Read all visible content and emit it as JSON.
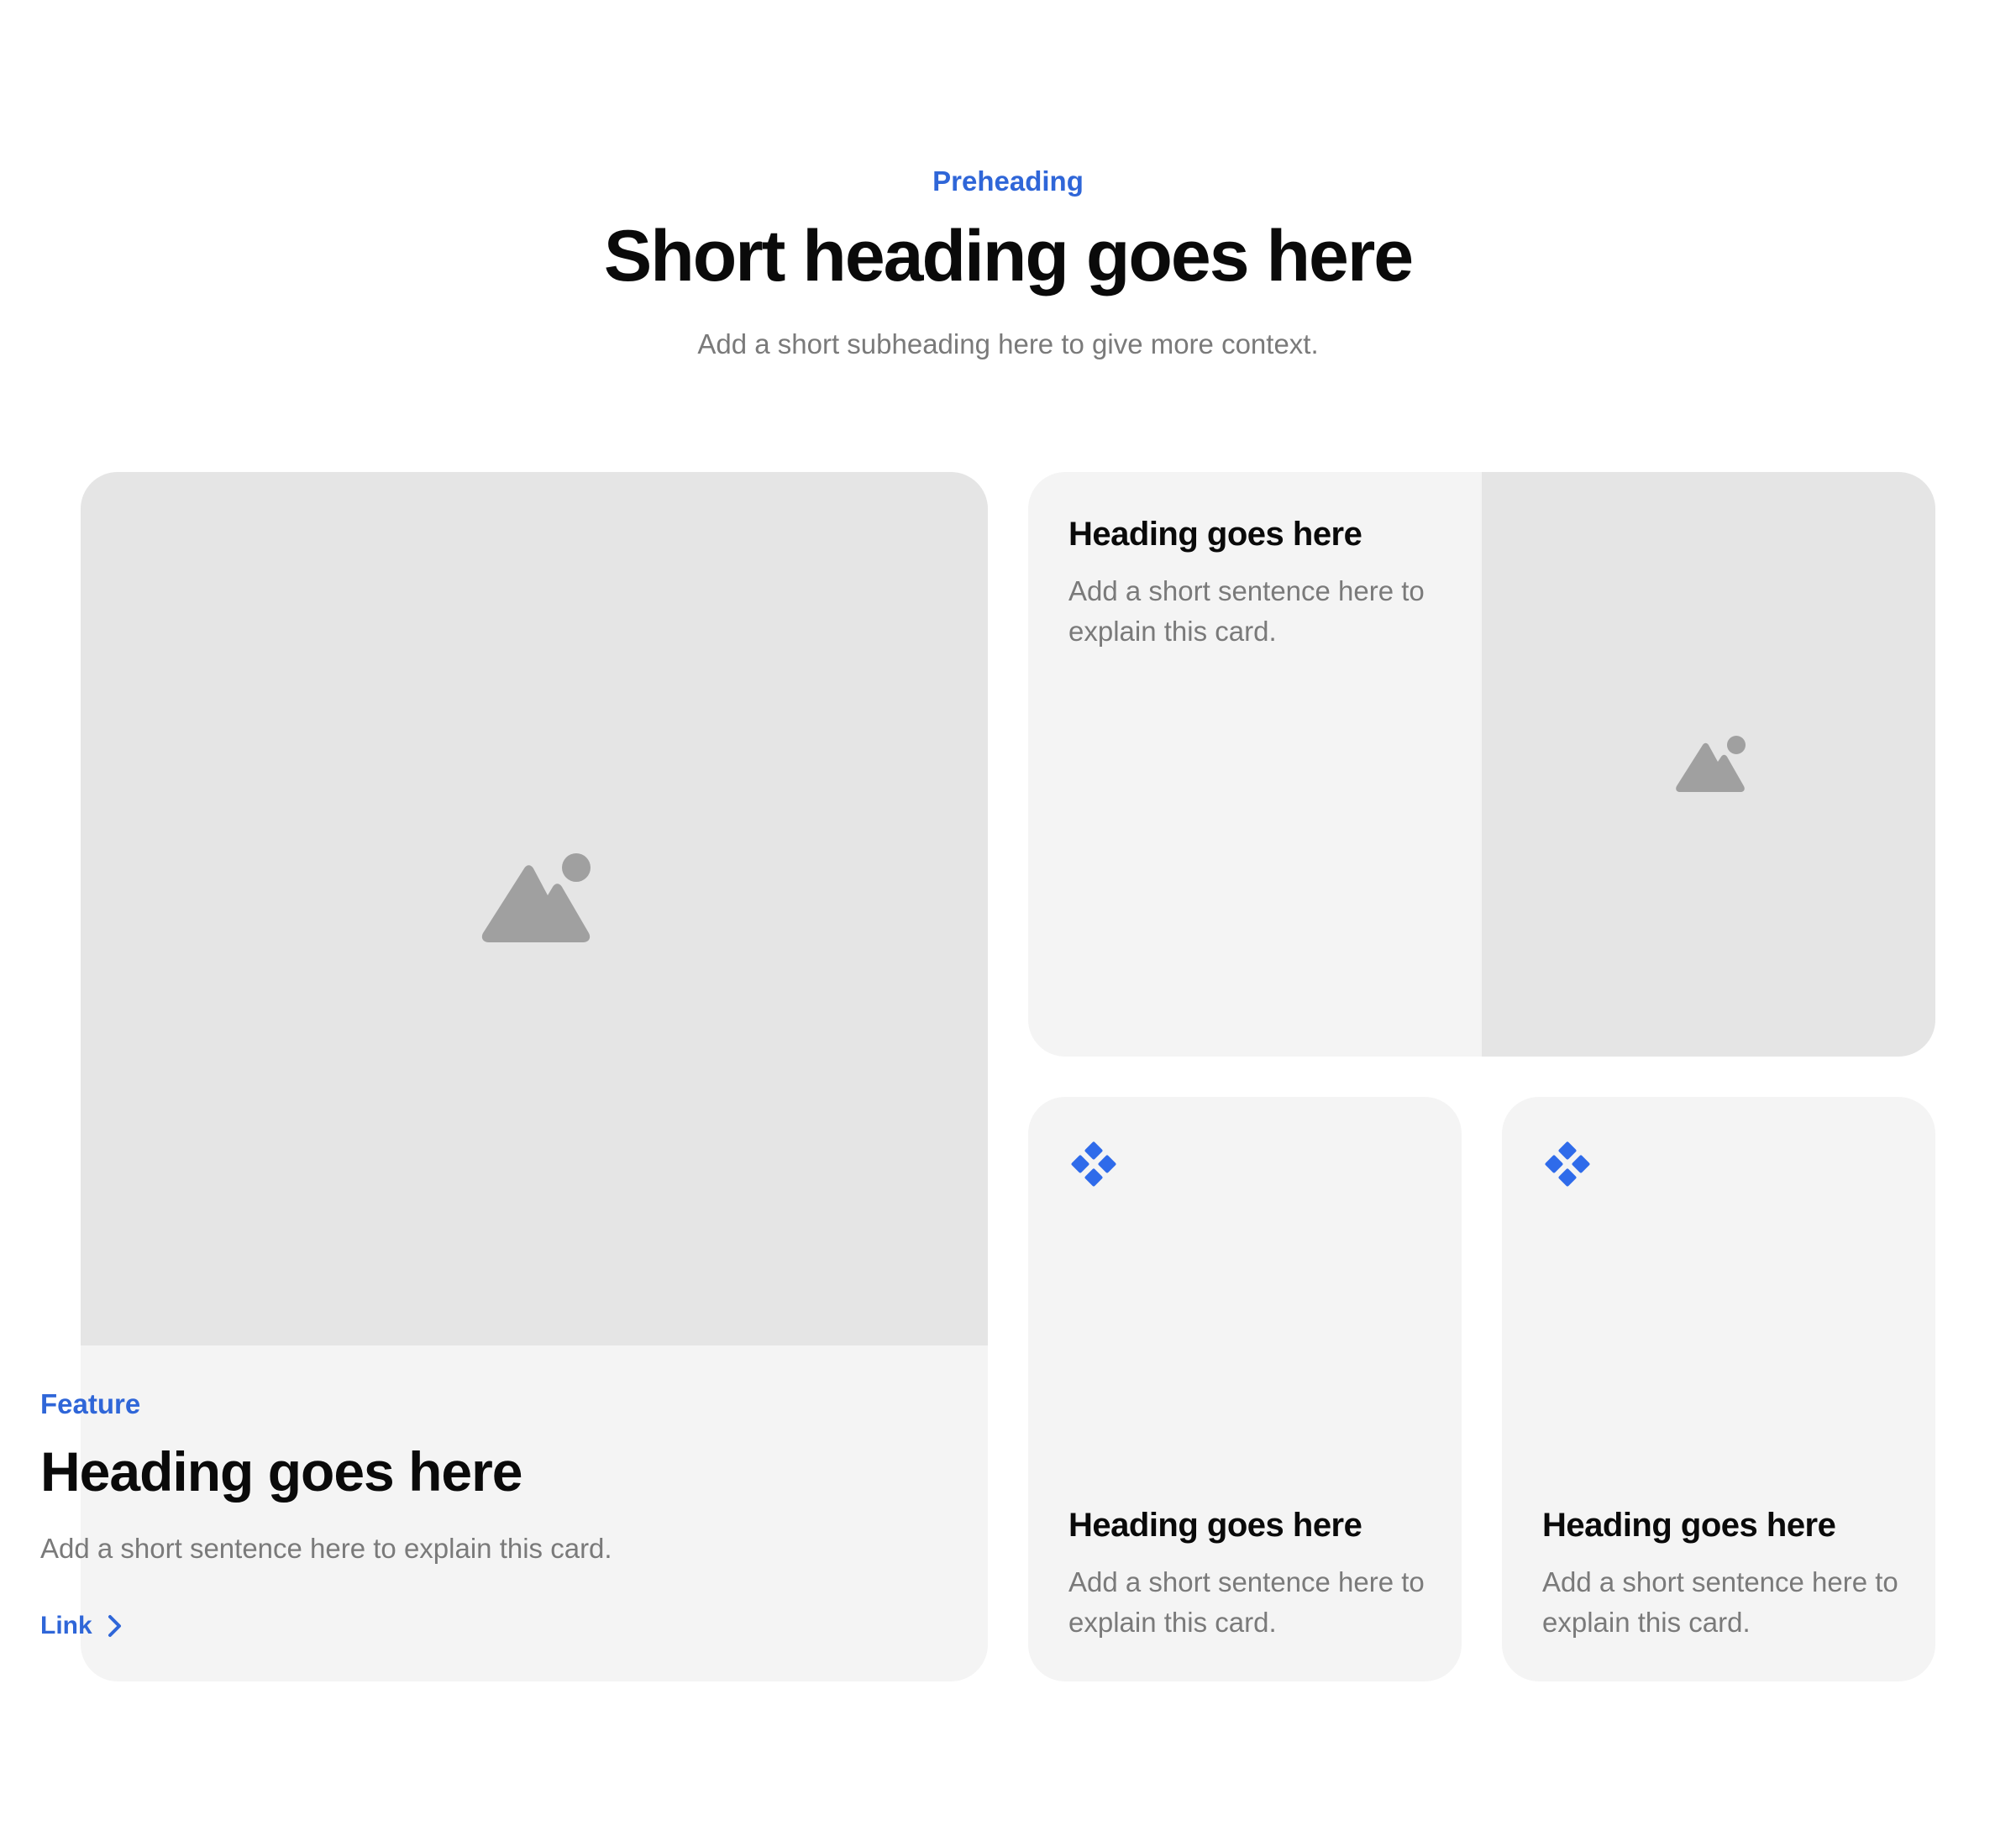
{
  "header": {
    "preheading": "Preheading",
    "heading": "Short heading goes here",
    "subheading": "Add a short subheading here to give more context."
  },
  "feature_card": {
    "image_icon": "image-placeholder-icon",
    "label": "Feature",
    "heading": "Heading goes here",
    "text": "Add a short sentence here to explain this card.",
    "link_label": "Link",
    "link_icon": "chevron-right-icon"
  },
  "split_card": {
    "heading": "Heading goes here",
    "text": "Add a short sentence here to explain this card.",
    "image_icon": "image-placeholder-icon"
  },
  "small_cards": [
    {
      "icon": "diamond-grid-icon",
      "heading": "Heading goes here",
      "text": "Add a short sentence here to explain this card."
    },
    {
      "icon": "diamond-grid-icon",
      "heading": "Heading goes here",
      "text": "Add a short sentence here to explain this card."
    }
  ],
  "colors": {
    "accent": "#2f66d8",
    "icon_blue": "#2f6bea",
    "card_bg": "#f4f4f4",
    "media_bg": "#e5e5e5",
    "placeholder_icon": "#a0a0a0",
    "muted_text": "#7a7a7a",
    "heading_text": "#0a0a0a"
  }
}
